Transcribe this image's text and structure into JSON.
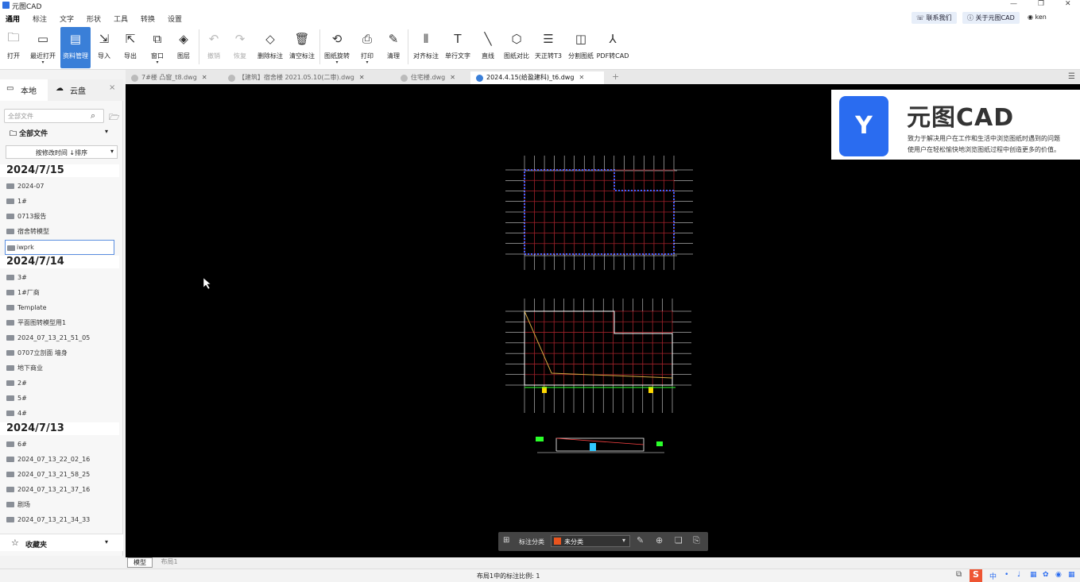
{
  "app": {
    "title": "元图CAD"
  },
  "menubar": {
    "items": [
      "通用",
      "标注",
      "文字",
      "形状",
      "工具",
      "转换",
      "设置"
    ],
    "contact": "联系我们",
    "about": "关于元图CAD",
    "user": "ken"
  },
  "ribbon": {
    "buttons": [
      {
        "label": "打开",
        "icon": "folder-open-icon"
      },
      {
        "label": "最近打开",
        "icon": "recent-icon",
        "dropdown": true
      },
      {
        "label": "资料管理",
        "icon": "document-manage-icon"
      },
      {
        "label": "导入",
        "icon": "import-icon"
      },
      {
        "label": "导出",
        "icon": "export-icon"
      },
      {
        "label": "窗口",
        "icon": "window-icon",
        "dropdown": true
      },
      {
        "label": "图层",
        "icon": "layers-icon"
      },
      {
        "label": "撤销",
        "icon": "undo-icon"
      },
      {
        "label": "恢复",
        "icon": "redo-icon"
      },
      {
        "label": "删除标注",
        "icon": "eraser-icon"
      },
      {
        "label": "清空标注",
        "icon": "trash-icon"
      },
      {
        "label": "图纸旋转",
        "icon": "rotate-icon",
        "dropdown": true
      },
      {
        "label": "打印",
        "icon": "print-icon",
        "dropdown": true
      },
      {
        "label": "清理",
        "icon": "brush-icon"
      },
      {
        "label": "对齐标注",
        "icon": "align-icon"
      },
      {
        "label": "单行文字",
        "icon": "text-icon"
      },
      {
        "label": "直线",
        "icon": "line-icon"
      },
      {
        "label": "图纸对比",
        "icon": "compare-icon"
      },
      {
        "label": "天正转T3",
        "icon": "convert-icon"
      },
      {
        "label": "分割图纸",
        "icon": "split-icon"
      },
      {
        "label": "PDF转CAD",
        "icon": "pdf-icon"
      }
    ]
  },
  "sidebar": {
    "tab_local": "本地",
    "tab_cloud": "云盘",
    "search_placeholder": "全部文件",
    "all_files": "全部文件",
    "sort_label": "按修改时间 ↓排序",
    "groups": [
      {
        "date": "2024/7/15",
        "items": [
          "2024-07",
          "1#",
          "0713报告",
          "宿舍转模型",
          "iwprk"
        ]
      },
      {
        "date": "2024/7/14",
        "items": [
          "3#",
          "1#厂商",
          "Template",
          "平面图转模型用1",
          "2024_07_13_21_51_05",
          "0707立剖面 墙身",
          "地下商业",
          "2#",
          "5#",
          "4#"
        ]
      },
      {
        "date": "2024/7/13",
        "items": [
          "6#",
          "2024_07_13_22_02_16",
          "2024_07_13_21_58_25",
          "2024_07_13_21_37_16",
          "剧场",
          "2024_07_13_21_34_33"
        ]
      }
    ],
    "favorites": "收藏夹"
  },
  "tabs": [
    {
      "label": "7#楼 凸窗_t8.dwg",
      "active": false
    },
    {
      "label": "【建筑】宿舍楼 2021.05.10(二审).dwg",
      "active": false
    },
    {
      "label": "住宅楼.dwg",
      "active": false
    },
    {
      "label": "2024.4.15(给盈建科)_t6.dwg",
      "active": true
    }
  ],
  "banner": {
    "brand": "元图CAD",
    "line1": "致力于解决用户在工作和生活中浏览图纸时遇到的问题",
    "line2": "使用户在轻松愉快地浏览图纸过程中创造更多的价值。"
  },
  "bottom_toolbar": {
    "label": "标注分类",
    "selected": "未分类",
    "color": "#e8541e"
  },
  "layout_tabs": [
    "模型",
    "布局1"
  ],
  "status": {
    "text": "布局1中的标注比例: 1"
  },
  "colors": {
    "accent": "#3a7fd8",
    "canvas": "#000000"
  }
}
